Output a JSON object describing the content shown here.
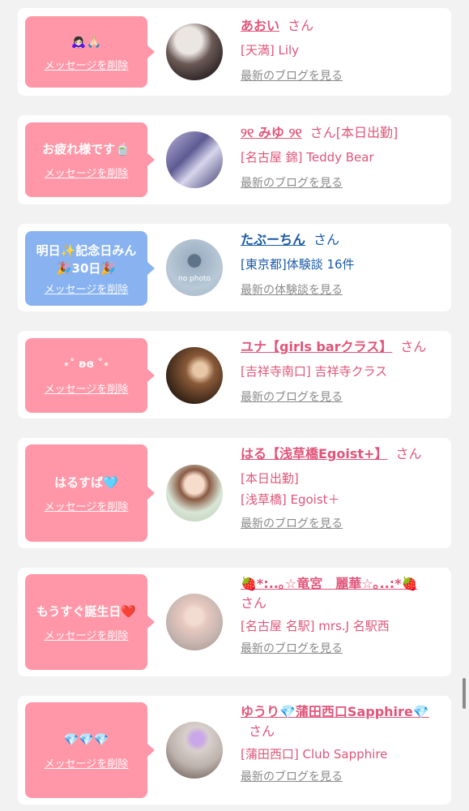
{
  "delete_label": "メッセージを削除",
  "san": "さん",
  "cards": [
    {
      "message": "🙇🏻‍♀️🙏🏻",
      "name": "あおい",
      "name_suffix": "",
      "shop": "[天満] Lily",
      "blog": "最新のブログを見る"
    },
    {
      "message": "お疲れ様です🍵",
      "name": "୨୧ みゆ ୨୧",
      "name_suffix": "[本日出勤]",
      "shop": "[名古屋 錦] Teddy Bear",
      "blog": "最新のブログを見る"
    },
    {
      "message": "明日✨記念日みん\n🎉30日🎉",
      "name": "たぶーちん",
      "name_suffix": "",
      "shop": "[東京都]体験談 16件",
      "blog": "最新の体験談を見る"
    },
    {
      "message": "⋆˚ ʚɞ ˚⋆",
      "name": "ユナ【girls barクラス】",
      "name_suffix": "",
      "shop": "[吉祥寺南口] 吉祥寺クラス",
      "blog": "最新のブログを見る"
    },
    {
      "message": "はるすば🩵",
      "name": "はる【浅草橋Egoist+】",
      "name_suffix": "",
      "shop": "[本日出勤]",
      "shop2": "[浅草橋] Egoist＋",
      "blog": "最新のブログを見る"
    },
    {
      "message": "もうすぐ誕生日❤️",
      "name": "🍓*:..｡☆竜宮　麗華☆｡..:*🍓",
      "name_suffix": "",
      "shop": "[名古屋 名駅] mrs.J 名駅西",
      "blog": "最新のブログを見る"
    },
    {
      "message": "💎💎💎",
      "name": "ゆうり💎蒲田西口Sapphire💎",
      "name_suffix": "",
      "shop": "[蒲田西口] Club Sapphire",
      "blog": "最新のブログを見る"
    }
  ],
  "no_photo": "no photo",
  "colors": {
    "pink_bubble": "#ff97a8",
    "blue_bubble": "#88b2f0",
    "name_pink": "#e0557a",
    "name_blue": "#1a5aa6"
  }
}
